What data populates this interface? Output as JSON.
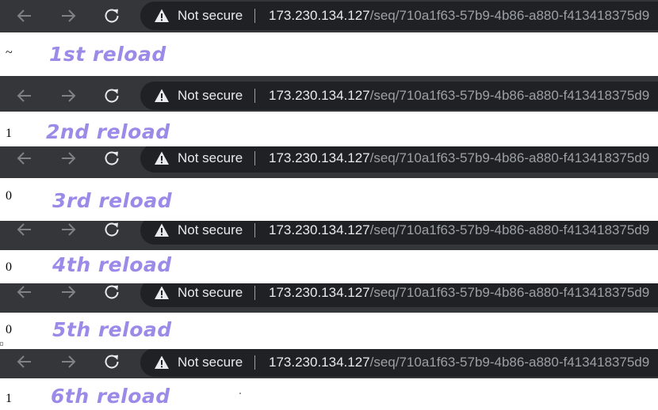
{
  "colors": {
    "toolbar_bg": "#35363a",
    "omnibox_bg": "#202124",
    "text_primary": "#e8eaed",
    "text_muted": "#9aa0a6",
    "nav_icon": "#7f8186",
    "reload_icon": "#e8eaed",
    "annotation": "#9c8ae8",
    "page_bg": "#ffffff"
  },
  "icons": {
    "back": "arrow-left-icon",
    "forward": "arrow-right-icon",
    "reload": "reload-icon",
    "security": "warning-triangle-icon"
  },
  "browser": {
    "security_label": "Not secure",
    "url_host": "173.230.134.127",
    "url_path": "/seq/710a1f63-57b9-4b86-a880-f413418375d9"
  },
  "snapshots": [
    {
      "page_text": "~",
      "annotation": "1st reload"
    },
    {
      "page_text": "1",
      "annotation": "2nd reload"
    },
    {
      "page_text": "0",
      "annotation": "3rd reload"
    },
    {
      "page_text": "0",
      "annotation": "4th reload"
    },
    {
      "page_text": "0",
      "annotation": "5th reload"
    },
    {
      "page_text": "1",
      "annotation": "6th reload"
    }
  ]
}
